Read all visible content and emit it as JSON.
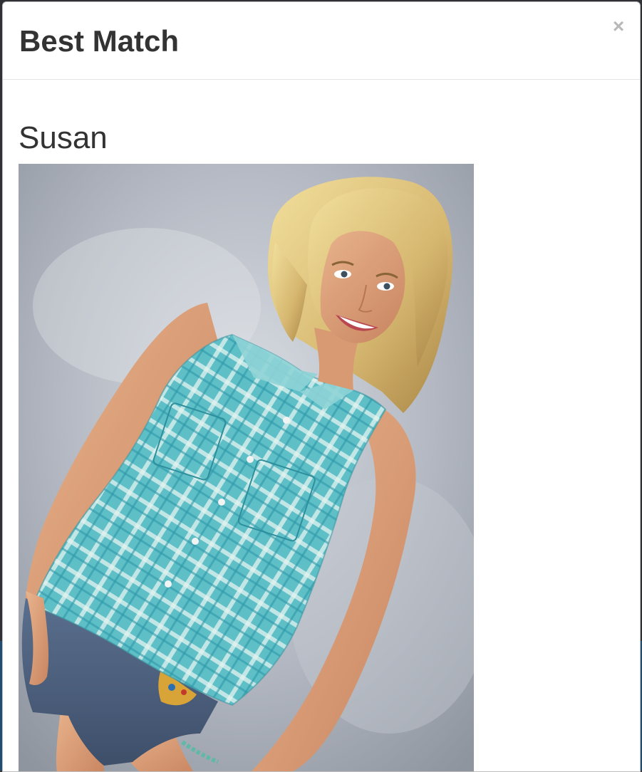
{
  "modal": {
    "title": "Best Match",
    "close_label": "×"
  },
  "match": {
    "name": "Susan",
    "photo_alt": "Susan",
    "photo_description": "Smiling blonde woman in a turquoise plaid sleeveless button-up shirt and denim shorts against a gray studio backdrop"
  },
  "colors": {
    "title_text": "#333333",
    "close_icon": "#b8b8b8",
    "shirt": "#6cc3c9",
    "backdrop": "#a9adb5"
  }
}
